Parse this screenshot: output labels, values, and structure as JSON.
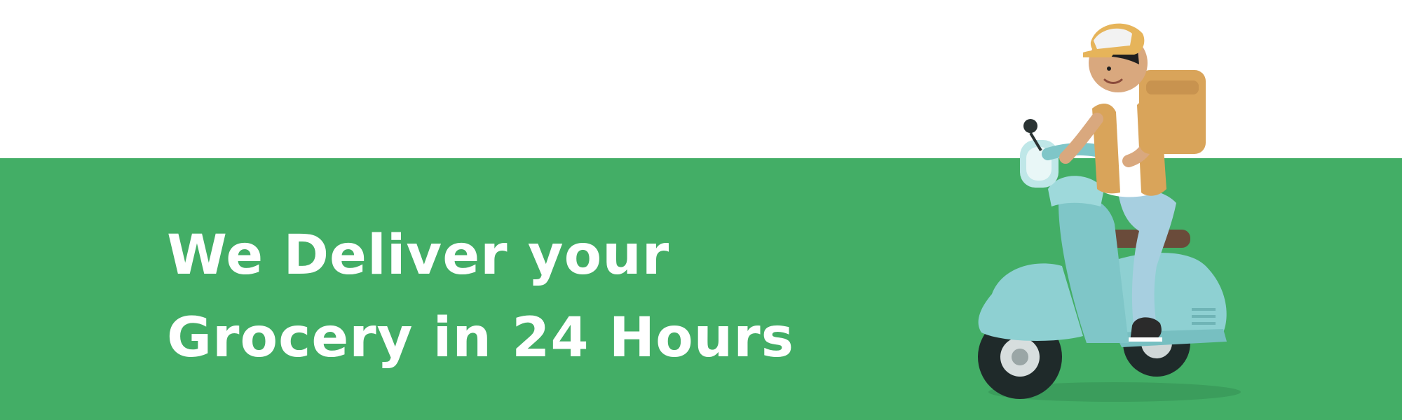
{
  "banner": {
    "headline_line1": "We Deliver your",
    "headline_line2": "Grocery in 24 Hours",
    "illustration_icon": "delivery-scooter-rider-icon"
  },
  "colors": {
    "background_top": "#ffffff",
    "background_bottom": "#43ae66",
    "headline_text": "#ffffff",
    "scooter_body": "#8ed0d2",
    "delivery_box": "#d9a45a",
    "cap": "#e6b45a",
    "jeans": "#a7cfe0",
    "tire": "#1f2a2a"
  }
}
